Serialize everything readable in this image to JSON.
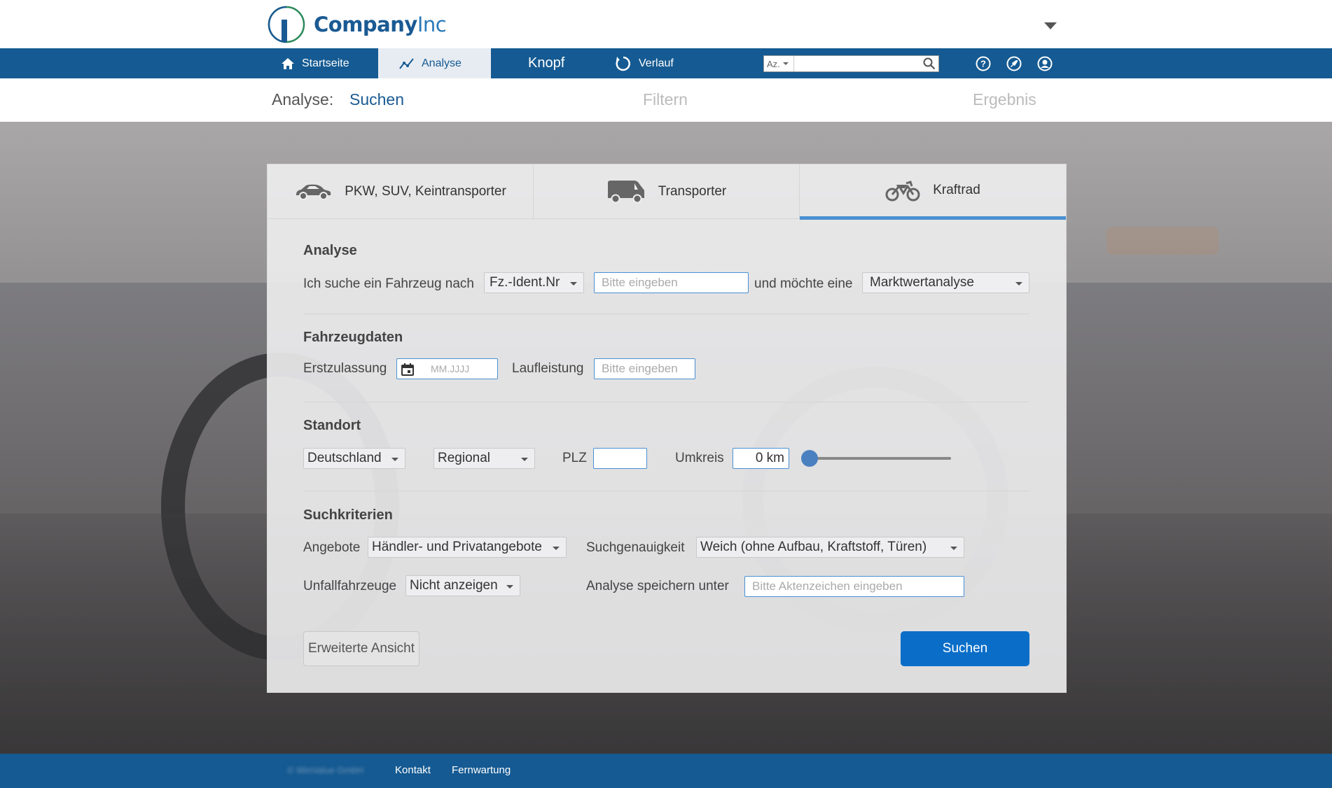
{
  "brand": {
    "name_bold": "Company",
    "name_light": "Inc"
  },
  "nav": {
    "items": [
      {
        "label": "Startseite",
        "icon": "home-icon"
      },
      {
        "label": "Analyse",
        "icon": "analysis-icon",
        "active": true
      },
      {
        "label": "Knopf"
      },
      {
        "label": "Verlauf",
        "icon": "history-icon"
      }
    ],
    "search": {
      "scope": "Az.",
      "value": "",
      "icon": "search-icon"
    },
    "icons": [
      "help-icon",
      "rocket-icon",
      "user-icon"
    ]
  },
  "steps": {
    "label": "Analyse:",
    "current": "Suchen",
    "next": "Filtern",
    "last": "Ergebnis"
  },
  "tabs": [
    {
      "label": "PKW, SUV, Keintransporter",
      "icon": "car-icon"
    },
    {
      "label": "Transporter",
      "icon": "van-icon"
    },
    {
      "label": "Kraftrad",
      "icon": "motorcycle-icon",
      "active": true
    }
  ],
  "analyse": {
    "title": "Analyse",
    "prefix": "Ich suche ein Fahrzeug nach",
    "search_by": "Fz.-Ident.Nr",
    "input_placeholder": "Bitte eingeben",
    "middle": "und möchte eine",
    "analysis_type": "Marktwertanalyse"
  },
  "fahrzeugdaten": {
    "title": "Fahrzeugdaten",
    "erstzulassung_label": "Erstzulassung",
    "erstzulassung_placeholder": "MM.JJJJ",
    "laufleistung_label": "Laufleistung",
    "laufleistung_placeholder": "Bitte eingeben"
  },
  "standort": {
    "title": "Standort",
    "country": "Deutschland",
    "region": "Regional",
    "plz_label": "PLZ",
    "plz_value": "",
    "umkreis_label": "Umkreis",
    "umkreis_value": "0 km",
    "slider_fraction": 0
  },
  "suchkriterien": {
    "title": "Suchkriterien",
    "angebote_label": "Angebote",
    "angebote_value": "Händler- und Privatangebote",
    "genauigkeit_label": "Suchgenauigkeit",
    "genauigkeit_value": "Weich (ohne Aufbau, Kraftstoff, Türen)",
    "unfall_label": "Unfallfahrzeuge",
    "unfall_value": "Nicht anzeigen",
    "speichern_label": "Analyse speichern unter",
    "speichern_placeholder": "Bitte Aktenzeichen eingeben"
  },
  "buttons": {
    "advanced": "Erweiterte Ansicht",
    "search": "Suchen"
  },
  "footer": {
    "copyright": "© WinValue GmbH",
    "kontakt": "Kontakt",
    "fernwartung": "Fernwartung"
  },
  "colors": {
    "nav_blue": "#155a92",
    "accent": "#4a90d2",
    "primary_button": "#0a6ec9"
  }
}
